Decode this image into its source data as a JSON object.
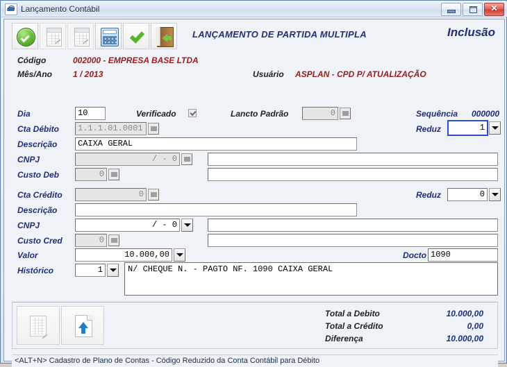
{
  "window": {
    "title": "Lançamento Contábil",
    "icon": "app-icon",
    "minimize_label": "",
    "maximize_label": "",
    "close_label": "✕"
  },
  "toolbar": {
    "buttons": [
      {
        "name": "confirm-button",
        "icon": "green-circle-check-icon",
        "enabled": true
      },
      {
        "name": "ledger-button-1",
        "icon": "ledger-edit-icon",
        "enabled": false
      },
      {
        "name": "ledger-button-2",
        "icon": "ledger-edit-icon",
        "enabled": false
      },
      {
        "name": "calculator-button",
        "icon": "calculator-icon",
        "enabled": true
      },
      {
        "name": "validate-button",
        "icon": "green-check-icon",
        "enabled": true
      },
      {
        "name": "exit-button",
        "icon": "exit-door-icon",
        "enabled": true
      }
    ],
    "title": "LANÇAMENTO DE PARTIDA MULTIPLA",
    "mode": "Inclusão"
  },
  "header": {
    "codigo_label": "Código",
    "codigo_value": "002000 - EMPRESA BASE LTDA",
    "mesano_label": "Mês/Ano",
    "mesano_value": "1 / 2013",
    "usuario_label": "Usuário",
    "usuario_value": "ASPLAN - CPD P/ ATUALIZAÇÃO"
  },
  "form": {
    "dia_label": "Dia",
    "dia_value": "10",
    "verificado_label": "Verificado",
    "verificado_checked": true,
    "lancto_padrao_label": "Lancto Padrão",
    "lancto_padrao_value": "0",
    "sequencia_label": "Sequência",
    "sequencia_value": "000000",
    "cta_debito_label": "Cta Débito",
    "cta_debito_value": "1.1.1.01.0001",
    "reduz_debito_label": "Reduz",
    "reduz_debito_value": "1",
    "descricao_debito_label": "Descrição",
    "descricao_debito_value": "CAIXA GERAL",
    "cnpj_debito_label": "CNPJ",
    "cnpj_debito_value": "/          - 0",
    "cnpj_debito_name_value": "",
    "custo_deb_label": "Custo Deb",
    "custo_deb_value": "0",
    "custo_deb_name_value": "",
    "cta_credito_label": "Cta Crédito",
    "cta_credito_value": "0",
    "reduz_credito_label": "Reduz",
    "reduz_credito_value": "0",
    "descricao_credito_label": "Descrição",
    "descricao_credito_value": "",
    "cnpj_credito_label": "CNPJ",
    "cnpj_credito_value": "/          - 0",
    "cnpj_credito_name_value": "",
    "custo_cred_label": "Custo Cred",
    "custo_cred_value": "0",
    "custo_cred_name_value": "",
    "valor_label": "Valor",
    "valor_value": "10.000,00",
    "docto_label": "Docto",
    "docto_value": "1090",
    "historico_label": "Histórico",
    "historico_code_value": "1",
    "historico_text_value": "N/ CHEQUE N.  - PAGTO NF. 1090 CAIXA GERAL"
  },
  "totals": {
    "buttons": [
      {
        "name": "grid-button",
        "icon": "grid-edit-icon",
        "enabled": false
      },
      {
        "name": "import-button",
        "icon": "document-up-arrow-icon",
        "enabled": true
      }
    ],
    "rows": [
      {
        "label": "Total a Debito",
        "value": "10.000,00"
      },
      {
        "label": "Total a Crédito",
        "value": "0,00"
      },
      {
        "label": "Diferença",
        "value": "10.000,00"
      }
    ]
  },
  "statusbar": {
    "text": "<ALT+N> Cadastro de Plano de Contas - Código Reduzido da Conta Contábil para Débito"
  },
  "colors": {
    "label_blue": "#1f2f7a",
    "header_red": "#9b1c1c",
    "focus_blue": "#2a4ec7",
    "titlebar": "#dce7f5"
  }
}
